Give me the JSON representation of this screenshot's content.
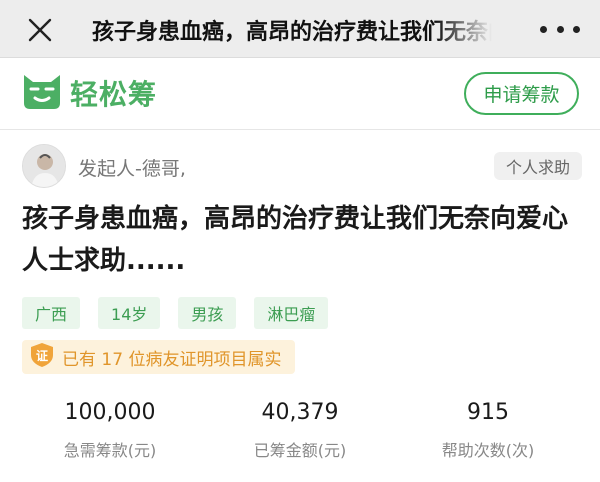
{
  "navbar": {
    "title": "孩子身患血癌，高昂的治疗费让我们无奈向爱心人士求助......",
    "close_icon": "close-icon",
    "more_icon": "more-dots-icon",
    "background": "#ededed"
  },
  "brand": {
    "name": "轻松筹",
    "logo_icon": "qingsongchou-cat-logo",
    "apply_button": "申请筹款",
    "accent_color": "#3fae5b"
  },
  "initiator": {
    "name": "发起人-德哥,",
    "type_badge": "个人求助"
  },
  "headline": "孩子身患血癌，高昂的治疗费让我们无奈向爱心人士求助......",
  "tags": [
    "广西",
    "14岁",
    "男孩",
    "淋巴瘤"
  ],
  "verification": {
    "icon_char": "证",
    "text": "已有 17 位病友证明项目属实",
    "color": "#e0952a"
  },
  "stats": [
    {
      "value": "100,000",
      "label": "急需筹款(元)"
    },
    {
      "value": "40,379",
      "label": "已筹金额(元)"
    },
    {
      "value": "915",
      "label": "帮助次数(次)"
    }
  ]
}
